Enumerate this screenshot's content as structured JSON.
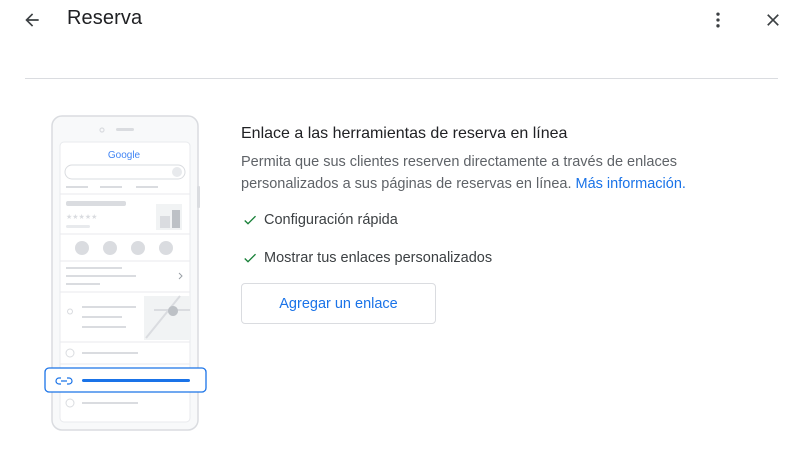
{
  "header": {
    "title": "Reserva"
  },
  "illustration": {
    "brand": "Google"
  },
  "content": {
    "heading": "Enlace a las herramientas de reserva en línea",
    "description": "Permita que sus clientes reserven directamente a través de enlaces personalizados a sus páginas de reservas en línea.",
    "more_info_link": "Más información.",
    "features": [
      {
        "label": "Configuración rápida",
        "icon": "check-icon"
      },
      {
        "label": "Mostrar tus enlaces personalizados",
        "icon": "check-icon"
      }
    ],
    "add_button_label": "Agregar un enlace"
  },
  "colors": {
    "accent": "#1a73e8",
    "text_primary": "#202124",
    "text_secondary": "#5f6368",
    "divider": "#dadce0",
    "check": "#188038"
  }
}
